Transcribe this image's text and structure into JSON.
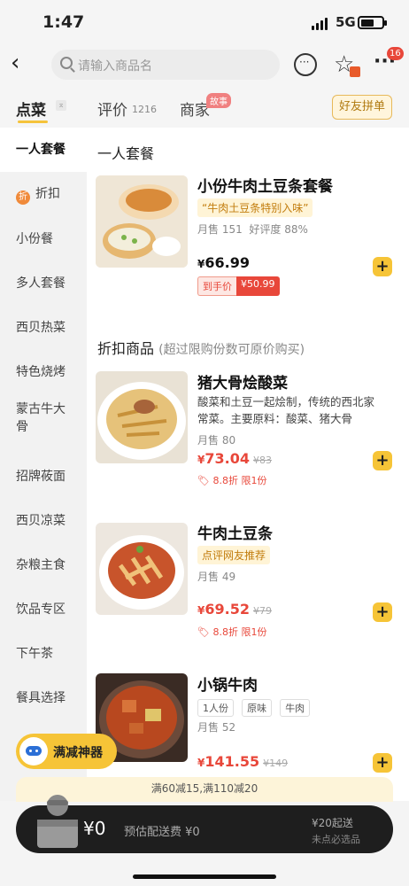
{
  "status": {
    "time": "1:47",
    "network": "5G"
  },
  "header": {
    "search_placeholder": "请输入商品名",
    "more_badge": "16"
  },
  "tabs": {
    "order": "点菜",
    "review": "评价",
    "review_count": "1216",
    "shop": "商家",
    "shop_badge": "故事",
    "group_button": "好友拼单"
  },
  "sidebar": {
    "items": [
      "一人套餐",
      "折扣",
      "小份餐",
      "多人套餐",
      "西贝热菜",
      "特色烧烤",
      "蒙古牛大骨",
      "招牌莜面",
      "西贝凉菜",
      "杂粮主食",
      "饮品专区",
      "下午茶",
      "餐具选择"
    ],
    "discount_icon": "折"
  },
  "sections": {
    "set_meal": "一人套餐",
    "discount": "折扣商品",
    "discount_note": "(超过限购份数可原价购买)"
  },
  "dishes": [
    {
      "name": "小份牛肉土豆条套餐",
      "tag": "“牛肉土豆条特别入味”",
      "sales": "月售 151",
      "rating": "好评度 88%",
      "price": "66.99",
      "hand_label": "到手价",
      "hand_price": "¥50.99"
    },
    {
      "name": "猪大骨烩酸菜",
      "desc": "酸菜和土豆一起烩制，传统的西北家常菜。主要原料：酸菜、猪大骨",
      "sales": "月售 80",
      "price": "73.04",
      "orig": "¥83",
      "discount": "8.8折 限1份"
    },
    {
      "name": "牛肉土豆条",
      "tag": "点评网友推荐",
      "sales": "月售 49",
      "price": "69.52",
      "orig": "¥79",
      "discount": "8.8折 限1份"
    },
    {
      "name": "小锅牛肉",
      "chips": [
        "1人份",
        "原味",
        "牛肉"
      ],
      "sales": "月售 52",
      "price": "141.55",
      "orig": "¥149"
    }
  ],
  "promo": {
    "float_label": "满减神器",
    "strip": "满60减15,满110减20"
  },
  "cart": {
    "amount": "¥0",
    "fee": "预估配送费 ¥0",
    "min_order": "¥20起送",
    "required_note": "未点必选品"
  },
  "colors": {
    "accent_yellow": "#f6c437",
    "price_red": "#e8473a",
    "dark_bar": "#1e1e1e"
  }
}
